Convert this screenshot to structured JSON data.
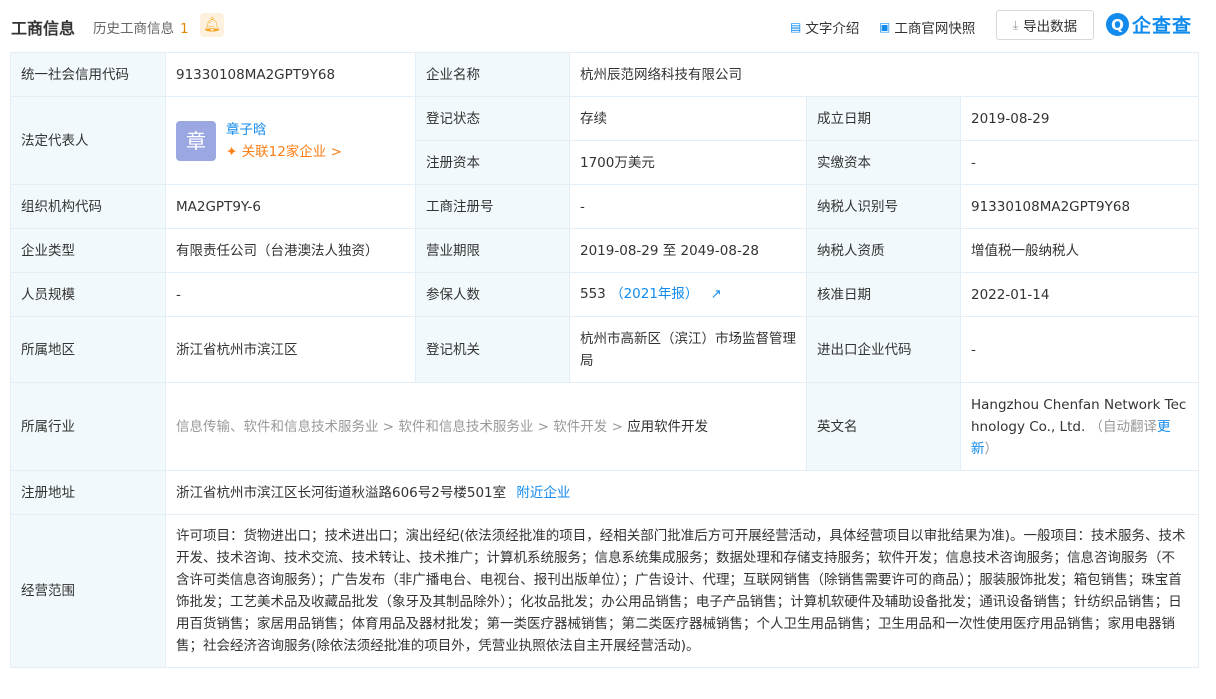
{
  "header": {
    "title": "工商信息",
    "history_label": "历史工商信息",
    "history_count": "1",
    "links": {
      "text_intro": "文字介绍",
      "snapshot": "工商官网快照",
      "export": "导出数据"
    },
    "brand": {
      "logo_letter": "Q",
      "name": "企查查"
    }
  },
  "rows": {
    "credit_code": {
      "label": "统一社会信用代码",
      "value": "91330108MA2GPT9Y68"
    },
    "company_name": {
      "label": "企业名称",
      "value": "杭州辰范网络科技有限公司"
    },
    "legal_rep": {
      "label": "法定代表人",
      "avatar_char": "章",
      "name": "章子晗",
      "related": "关联12家企业 >"
    },
    "reg_status": {
      "label": "登记状态",
      "value": "存续"
    },
    "founded": {
      "label": "成立日期",
      "value": "2019-08-29"
    },
    "reg_capital": {
      "label": "注册资本",
      "value": "1700万美元"
    },
    "paid_capital": {
      "label": "实缴资本",
      "value": "-"
    },
    "org_code": {
      "label": "组织机构代码",
      "value": "MA2GPT9Y-6"
    },
    "reg_no": {
      "label": "工商注册号",
      "value": "-"
    },
    "taxpayer_id": {
      "label": "纳税人识别号",
      "value": "91330108MA2GPT9Y68"
    },
    "company_type": {
      "label": "企业类型",
      "value": "有限责任公司（台港澳法人独资）"
    },
    "business_term": {
      "label": "营业期限",
      "value": "2019-08-29 至 2049-08-28"
    },
    "taxpayer_qual": {
      "label": "纳税人资质",
      "value": "增值税一般纳税人"
    },
    "staff_size": {
      "label": "人员规模",
      "value": "-"
    },
    "insured": {
      "label": "参保人数",
      "value": "553",
      "report": "（2021年报）"
    },
    "approve_date": {
      "label": "核准日期",
      "value": "2022-01-14"
    },
    "region": {
      "label": "所属地区",
      "value": "浙江省杭州市滨江区"
    },
    "authority": {
      "label": "登记机关",
      "value": "杭州市高新区（滨江）市场监督管理局"
    },
    "ie_code": {
      "label": "进出口企业代码",
      "value": "-"
    },
    "industry": {
      "label": "所属行业",
      "path": "信息传输、软件和信息技术服务业 > 软件和信息技术服务业 > 软件开发 >",
      "leaf": "应用软件开发"
    },
    "english_name": {
      "label": "英文名",
      "value": "Hangzhou Chenfan Network Technology Co., Ltd.",
      "note_prefix": "（自动翻译",
      "note_link": "更新",
      "note_suffix": "）"
    },
    "address": {
      "label": "注册地址",
      "value": "浙江省杭州市滨江区长河街道秋溢路606号2号楼501室",
      "nearby": "附近企业"
    },
    "scope": {
      "label": "经营范围",
      "value": "许可项目：货物进出口；技术进出口；演出经纪(依法须经批准的项目，经相关部门批准后方可开展经营活动，具体经营项目以审批结果为准)。一般项目：技术服务、技术开发、技术咨询、技术交流、技术转让、技术推广；计算机系统服务；信息系统集成服务；数据处理和存储支持服务；软件开发；信息技术咨询服务；信息咨询服务（不含许可类信息咨询服务）；广告发布（非广播电台、电视台、报刊出版单位）；广告设计、代理；互联网销售（除销售需要许可的商品）；服装服饰批发；箱包销售；珠宝首饰批发；工艺美术品及收藏品批发（象牙及其制品除外）；化妆品批发；办公用品销售；电子产品销售；计算机软硬件及辅助设备批发；通讯设备销售；针纺织品销售；日用百货销售；家居用品销售；体育用品及器材批发；第一类医疗器械销售；第二类医疗器械销售；个人卫生用品销售；卫生用品和一次性使用医疗用品销售；家用电器销售；社会经济咨询服务(除依法须经批准的项目外，凭营业执照依法自主开展经营活动)。"
    }
  },
  "icons": {
    "bell": "bell-icon",
    "doc": "document-icon",
    "camera": "camera-icon",
    "download": "download-icon",
    "chart": "trend-chart-icon",
    "relation": "relation-icon"
  },
  "colors": {
    "accent": "#128bed",
    "label_bg": "#f2f9fc",
    "border": "#e4eef6",
    "orange": "#fd7e14",
    "avatar": "#9aa7e0"
  }
}
